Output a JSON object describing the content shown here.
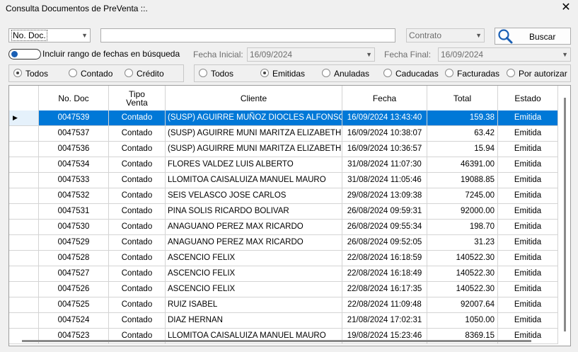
{
  "window": {
    "title": "Consulta Documentos de PreVenta ::.",
    "close_symbol": "✕"
  },
  "search": {
    "field_select": "No. Doc.",
    "text_value": "",
    "contract_select": "Contrato",
    "search_button": "Buscar"
  },
  "dates": {
    "include_range_label": "Incluir rango de fechas en búsqueda",
    "start_label": "Fecha Inicial:",
    "start_value": "16/09/2024",
    "end_label": "Fecha Final:",
    "end_value": "16/09/2024"
  },
  "sale_type_filter": {
    "options": [
      "Todos",
      "Contado",
      "Crédito"
    ],
    "selected": "Todos"
  },
  "status_filter": {
    "options": [
      "Todos",
      "Emitidas",
      "Anuladas",
      "Caducadas",
      "Facturadas",
      "Por autorizar"
    ],
    "selected": "Emitidas"
  },
  "table": {
    "columns": {
      "no_doc": "No. Doc",
      "tipo_venta_1": "Tipo",
      "tipo_venta_2": "Venta",
      "cliente": "Cliente",
      "fecha": "Fecha",
      "total": "Total",
      "estado": "Estado"
    },
    "current_row_marker": "▶",
    "rows": [
      {
        "no_doc": "0047539",
        "tipo": "Contado",
        "cliente": "(SUSP) AGUIRRE MUÑOZ DIOCLES ALFONSO",
        "fecha": "16/09/2024 13:43:40",
        "total": "159.38",
        "estado": "Emitida"
      },
      {
        "no_doc": "0047537",
        "tipo": "Contado",
        "cliente": "(SUSP) AGUIRRE MUNI MARITZA ELIZABETH",
        "fecha": "16/09/2024 10:38:07",
        "total": "63.42",
        "estado": "Emitida"
      },
      {
        "no_doc": "0047536",
        "tipo": "Contado",
        "cliente": "(SUSP) AGUIRRE MUNI MARITZA ELIZABETH",
        "fecha": "16/09/2024 10:36:57",
        "total": "15.94",
        "estado": "Emitida"
      },
      {
        "no_doc": "0047534",
        "tipo": "Contado",
        "cliente": "FLORES VALDEZ LUIS ALBERTO",
        "fecha": "31/08/2024 11:07:30",
        "total": "46391.00",
        "estado": "Emitida"
      },
      {
        "no_doc": "0047533",
        "tipo": "Contado",
        "cliente": "LLOMITOA CAISALUIZA MANUEL MAURO",
        "fecha": "31/08/2024 11:05:46",
        "total": "19088.85",
        "estado": "Emitida"
      },
      {
        "no_doc": "0047532",
        "tipo": "Contado",
        "cliente": "SEIS VELASCO JOSE CARLOS",
        "fecha": "29/08/2024 13:09:38",
        "total": "7245.00",
        "estado": "Emitida"
      },
      {
        "no_doc": "0047531",
        "tipo": "Contado",
        "cliente": "PINA SOLIS RICARDO BOLIVAR",
        "fecha": "26/08/2024 09:59:31",
        "total": "92000.00",
        "estado": "Emitida"
      },
      {
        "no_doc": "0047530",
        "tipo": "Contado",
        "cliente": "ANAGUANO PEREZ MAX RICARDO",
        "fecha": "26/08/2024 09:55:34",
        "total": "198.70",
        "estado": "Emitida"
      },
      {
        "no_doc": "0047529",
        "tipo": "Contado",
        "cliente": "ANAGUANO PEREZ MAX RICARDO",
        "fecha": "26/08/2024 09:52:05",
        "total": "31.23",
        "estado": "Emitida"
      },
      {
        "no_doc": "0047528",
        "tipo": "Contado",
        "cliente": "ASCENCIO FELIX",
        "fecha": "22/08/2024 16:18:59",
        "total": "140522.30",
        "estado": "Emitida"
      },
      {
        "no_doc": "0047527",
        "tipo": "Contado",
        "cliente": "ASCENCIO FELIX",
        "fecha": "22/08/2024 16:18:49",
        "total": "140522.30",
        "estado": "Emitida"
      },
      {
        "no_doc": "0047526",
        "tipo": "Contado",
        "cliente": "ASCENCIO FELIX",
        "fecha": "22/08/2024 16:17:35",
        "total": "140522.30",
        "estado": "Emitida"
      },
      {
        "no_doc": "0047525",
        "tipo": "Contado",
        "cliente": "RUIZ ISABEL",
        "fecha": "22/08/2024 11:09:48",
        "total": "92007.64",
        "estado": "Emitida"
      },
      {
        "no_doc": "0047524",
        "tipo": "Contado",
        "cliente": "DIAZ HERNAN",
        "fecha": "21/08/2024 17:02:31",
        "total": "1050.00",
        "estado": "Emitida"
      },
      {
        "no_doc": "0047523",
        "tipo": "Contado",
        "cliente": "LLOMITOA CAISALUIZA MANUEL MAURO",
        "fecha": "19/08/2024 15:23:46",
        "total": "8369.15",
        "estado": "Emitida"
      }
    ]
  },
  "colors": {
    "selection": "#0078d7",
    "search_icon": "#1a5fb4"
  }
}
